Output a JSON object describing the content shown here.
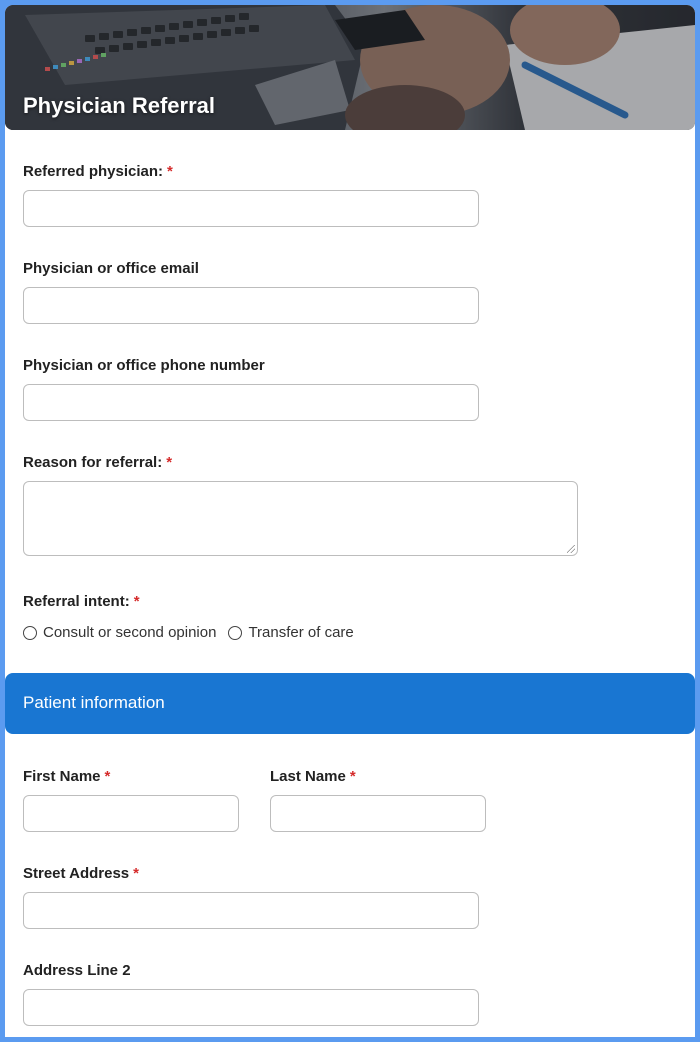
{
  "header": {
    "title": "Physician Referral"
  },
  "required_marker": "*",
  "fields": {
    "referred_physician": {
      "label": "Referred physician:",
      "value": ""
    },
    "email": {
      "label": "Physician or office email",
      "value": ""
    },
    "phone": {
      "label": "Physician or office phone number",
      "value": ""
    },
    "reason": {
      "label": "Reason for referral:",
      "value": ""
    },
    "intent": {
      "label": "Referral intent:",
      "options": [
        "Consult or second opinion",
        "Transfer of care"
      ]
    }
  },
  "patient_section": {
    "title": "Patient information",
    "first_name": {
      "label": "First Name",
      "value": ""
    },
    "last_name": {
      "label": "Last Name",
      "value": ""
    },
    "street": {
      "label": "Street Address",
      "value": ""
    },
    "address2": {
      "label": "Address Line 2",
      "value": ""
    }
  },
  "colors": {
    "accent": "#1976d2",
    "frame": "#5b9bf0",
    "required": "#d52b2b"
  }
}
